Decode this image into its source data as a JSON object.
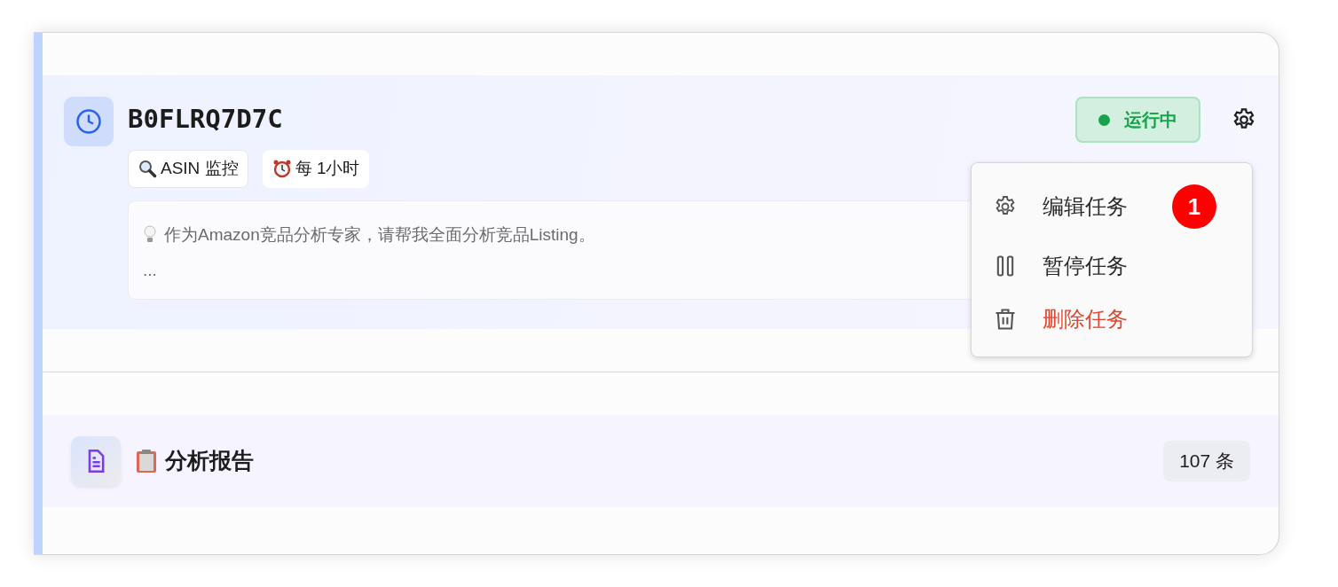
{
  "task": {
    "title": "B0FLRQ7D7C",
    "tags": [
      {
        "kind": "search",
        "label": "ASIN 监控"
      },
      {
        "kind": "alarm",
        "label": "每 1小时"
      }
    ],
    "prompt_lines": [
      "作为Amazon竞品分析专家，请帮我全面分析竞品Listing。",
      "..."
    ],
    "status": {
      "label": "运行中",
      "running": true
    }
  },
  "menu": {
    "items": [
      {
        "kind": "edit",
        "label": "编辑任务",
        "danger": false,
        "badge": "1"
      },
      {
        "kind": "pause",
        "label": "暂停任务",
        "danger": false
      },
      {
        "kind": "delete",
        "label": "删除任务",
        "danger": true
      }
    ]
  },
  "report": {
    "title": "分析报告",
    "count": "107 条"
  }
}
